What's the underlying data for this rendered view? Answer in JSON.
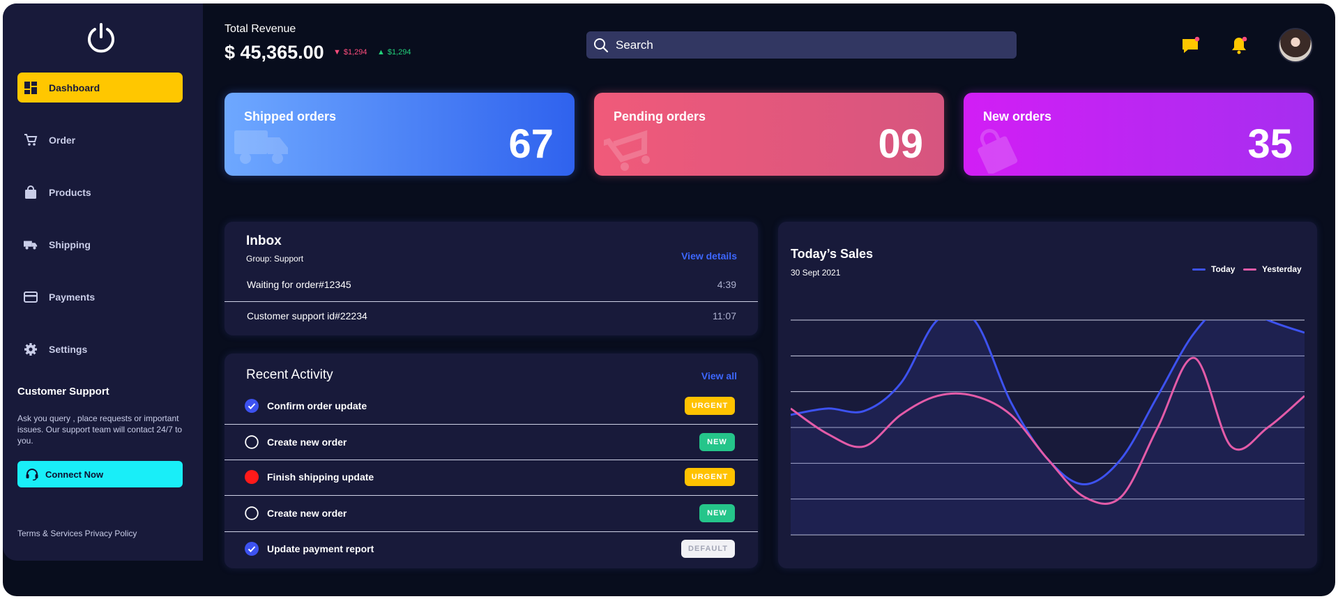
{
  "sidebar": {
    "items": [
      {
        "label": "Dashboard",
        "icon": "dashboard-icon",
        "active": true
      },
      {
        "label": "Order",
        "icon": "cart-icon",
        "active": false
      },
      {
        "label": "Products",
        "icon": "bag-icon",
        "active": false
      },
      {
        "label": "Shipping",
        "icon": "truck-icon",
        "active": false
      },
      {
        "label": "Payments",
        "icon": "card-icon",
        "active": false
      },
      {
        "label": "Settings",
        "icon": "gear-icon",
        "active": false
      }
    ],
    "support_title": "Customer Support",
    "support_text": "Ask you query , place requests or important issues. Our support team will contact 24/7 to you.",
    "connect_label": "Connect Now",
    "terms": "Terms & Services Privacy Policy"
  },
  "header": {
    "revenue_label": "Total Revenue",
    "revenue_value": "$ 45,365.00",
    "delta_down": "$1,294",
    "delta_up": "$1,294",
    "search_placeholder": "Search"
  },
  "cards": [
    {
      "title": "Shipped orders",
      "value": "67"
    },
    {
      "title": "Pending orders",
      "value": "09"
    },
    {
      "title": "New orders",
      "value": "35"
    }
  ],
  "inbox": {
    "title": "Inbox",
    "group": "Group: Support",
    "link": "View details",
    "rows": [
      {
        "text": "Waiting for order#12345",
        "time": "4:39"
      },
      {
        "text": "Customer support id#22234",
        "time": "11:07"
      }
    ]
  },
  "activity": {
    "title": "Recent Activity",
    "link": "View all",
    "rows": [
      {
        "text": "Confirm order update",
        "badge": "URGENT",
        "state": "done"
      },
      {
        "text": "Create new order",
        "badge": "NEW",
        "state": "open"
      },
      {
        "text": "Finish shipping update",
        "badge": "URGENT",
        "state": "blocked"
      },
      {
        "text": "Create new order",
        "badge": "NEW",
        "state": "open"
      },
      {
        "text": "Update payment report",
        "badge": "DEFAULT",
        "state": "done"
      }
    ]
  },
  "sales": {
    "title": "Today’s Sales",
    "date": "30 Sept 2021",
    "legend_today": "Today",
    "legend_yesterday": "Yesterday"
  },
  "colors": {
    "accent_yellow": "#ffc700",
    "accent_cyan": "#19eef8",
    "today_line": "#3d52f0",
    "yesterday_line": "#e35ba8",
    "background": "#080d1d",
    "panel": "#181a3a"
  },
  "chart_data": {
    "type": "line",
    "title": "Today’s Sales",
    "series": [
      {
        "name": "Today",
        "color": "#3d52f0",
        "values": [
          0.3,
          0.35,
          0.33,
          0.55,
          1.05,
          1.05,
          0.4,
          -0.05,
          -0.25,
          -0.05,
          0.45,
          0.95,
          1.2,
          1.05,
          0.95
        ]
      },
      {
        "name": "Yesterday",
        "color": "#e35ba8",
        "values": [
          0.35,
          0.15,
          0.05,
          0.3,
          0.45,
          0.45,
          0.3,
          -0.05,
          -0.35,
          -0.35,
          0.2,
          0.75,
          0.05,
          0.2,
          0.45
        ]
      }
    ],
    "x": [
      0,
      1,
      2,
      3,
      4,
      5,
      6,
      7,
      8,
      9,
      10,
      11,
      12,
      13,
      14
    ],
    "ylim": [
      -0.65,
      1.05
    ],
    "grid": true,
    "legend": "top-right"
  }
}
